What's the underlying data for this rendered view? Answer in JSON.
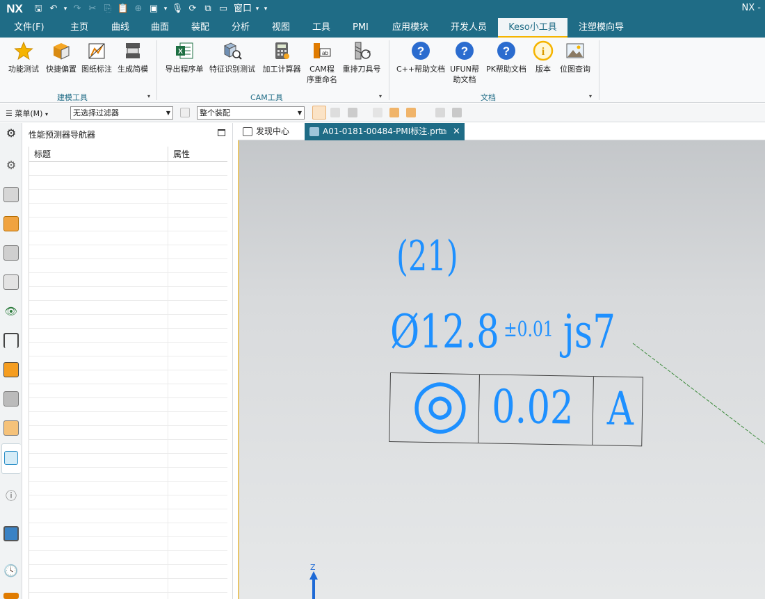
{
  "title_bar": {
    "logo": "NX",
    "window_menu": "窗口",
    "right_text": "NX -"
  },
  "menu_tabs": [
    "文件(F)",
    "主页",
    "曲线",
    "曲面",
    "装配",
    "分析",
    "视图",
    "工具",
    "PMI",
    "应用模块",
    "开发人员",
    "Keso小工具",
    "注塑模向导"
  ],
  "active_tab_index": 11,
  "ribbon": {
    "groups": [
      {
        "label": "建模工具",
        "buttons": [
          "功能测试",
          "快捷偏置",
          "图纸标注",
          "生成简模"
        ]
      },
      {
        "label": "CAM工具",
        "buttons": [
          "导出程序单",
          "特征识别测试",
          "加工计算器",
          "CAM程序重命名",
          "重排刀具号"
        ]
      },
      {
        "label": "文档",
        "buttons": [
          "C++帮助文档",
          "UFUN帮助文档",
          "PK帮助文档",
          "版本",
          "位图查询"
        ]
      }
    ],
    "cam_rename_label": [
      "CAM程",
      "序重命名"
    ],
    "ufun_label": [
      "UFUN帮",
      "助文档"
    ]
  },
  "toolbar2": {
    "menu_label": "菜单(M)",
    "filter_select": "无选择过滤器",
    "assembly_select": "整个装配"
  },
  "navigator": {
    "title": "性能预测器导航器",
    "columns": [
      "标题",
      "属性"
    ]
  },
  "doc_tabs": [
    {
      "label": "发现中心",
      "active": false
    },
    {
      "label": "A01-0181-00484-PMI标注.prt",
      "active": true
    }
  ],
  "pmi": {
    "count_label": "(21)",
    "diameter_symbol": "Ø",
    "diameter_value": "12.8",
    "tolerance": "±0.01",
    "fit_class": "js7",
    "fcf_symbol": "◎",
    "fcf_value": "0.02",
    "fcf_datum": "A",
    "axis_label": "Z"
  },
  "colors": {
    "title_bar": "#1f6c86",
    "active_tab_underline": "#f5b400",
    "pmi_blue": "#1e90ff",
    "leader_green": "#3b8a3b"
  }
}
